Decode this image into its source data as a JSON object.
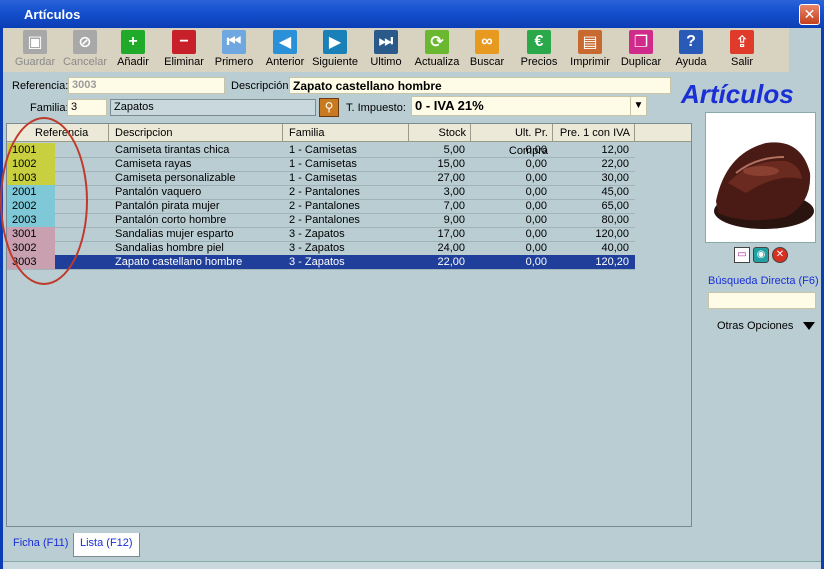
{
  "window": {
    "title": "Artículos",
    "close_label": "✕"
  },
  "toolbar": {
    "buttons": [
      {
        "label": "Guardar",
        "icon": "save-icon",
        "enabled": false,
        "color": "#a8a8a8"
      },
      {
        "label": "Cancelar",
        "icon": "cancel-icon",
        "enabled": false,
        "color": "#a8a8a8"
      },
      {
        "label": "Añadir",
        "icon": "plus-icon",
        "enabled": true,
        "color": "#1faa2a"
      },
      {
        "label": "Eliminar",
        "icon": "minus-icon",
        "enabled": true,
        "color": "#c8202a"
      },
      {
        "label": "Primero",
        "icon": "first-icon",
        "enabled": true,
        "color": "#6fa8e0"
      },
      {
        "label": "Anterior",
        "icon": "previous-icon",
        "enabled": true,
        "color": "#2a90d8"
      },
      {
        "label": "Siguiente",
        "icon": "next-icon",
        "enabled": true,
        "color": "#1a80b8"
      },
      {
        "label": "Ultimo",
        "icon": "last-icon",
        "enabled": true,
        "color": "#2a5a8a"
      },
      {
        "label": "Actualiza",
        "icon": "refresh-icon",
        "enabled": true,
        "color": "#6ab830"
      },
      {
        "label": "Buscar",
        "icon": "binoculars-icon",
        "enabled": true,
        "color": "#e89a20"
      },
      {
        "label": "Precios",
        "icon": "euro-icon",
        "enabled": true,
        "color": "#2aa84a"
      },
      {
        "label": "Imprimir",
        "icon": "printer-icon",
        "enabled": true,
        "color": "#c86a30"
      },
      {
        "label": "Duplicar",
        "icon": "duplicate-icon",
        "enabled": true,
        "color": "#d02a8a"
      },
      {
        "label": "Ayuda",
        "icon": "help-icon",
        "enabled": true,
        "color": "#2a5ab8"
      },
      {
        "label": "Salir",
        "icon": "exit-icon",
        "enabled": true,
        "color": "#e03a2a"
      }
    ]
  },
  "form": {
    "referencia_label": "Referencia:",
    "referencia_value": "3003",
    "descripcion_label": "Descripción:",
    "descripcion_value": "Zapato castellano hombre",
    "familia_label": "Familia:",
    "familia_code": "3",
    "familia_name": "Zapatos",
    "impuesto_label": "T. Impuesto:",
    "impuesto_value": "0 - IVA 21%"
  },
  "app_title": "Artículos",
  "grid": {
    "columns": [
      "Referencia",
      "Descripcion",
      "Familia",
      "Stock",
      "Ult. Pr. Compra",
      "Pre. 1 con IVA"
    ],
    "rows": [
      {
        "ref": "1001",
        "desc": "Camiseta tirantas chica",
        "familia": "1 - Camisetas",
        "stock": "5,00",
        "ult": "0,00",
        "pre": "12,00",
        "color": "#c8d040"
      },
      {
        "ref": "1002",
        "desc": "Camiseta rayas",
        "familia": "1 - Camisetas",
        "stock": "15,00",
        "ult": "0,00",
        "pre": "22,00",
        "color": "#c8d040"
      },
      {
        "ref": "1003",
        "desc": "Camiseta personalizable",
        "familia": "1 - Camisetas",
        "stock": "27,00",
        "ult": "0,00",
        "pre": "30,00",
        "color": "#c8d040"
      },
      {
        "ref": "2001",
        "desc": "Pantalón vaquero",
        "familia": "2 - Pantalones",
        "stock": "3,00",
        "ult": "0,00",
        "pre": "45,00",
        "color": "#7ec8d8"
      },
      {
        "ref": "2002",
        "desc": "Pantalón pirata mujer",
        "familia": "2 - Pantalones",
        "stock": "7,00",
        "ult": "0,00",
        "pre": "65,00",
        "color": "#7ec8d8"
      },
      {
        "ref": "2003",
        "desc": "Pantalón corto hombre",
        "familia": "2 - Pantalones",
        "stock": "9,00",
        "ult": "0,00",
        "pre": "80,00",
        "color": "#7ec8d8"
      },
      {
        "ref": "3001",
        "desc": "Sandalias mujer esparto",
        "familia": "3 - Zapatos",
        "stock": "17,00",
        "ult": "0,00",
        "pre": "120,00",
        "color": "#c8a0b0"
      },
      {
        "ref": "3002",
        "desc": "Sandalias hombre piel",
        "familia": "3 - Zapatos",
        "stock": "24,00",
        "ult": "0,00",
        "pre": "40,00",
        "color": "#c8a0b0"
      },
      {
        "ref": "3003",
        "desc": "Zapato castellano hombre",
        "familia": "3 - Zapatos",
        "stock": "22,00",
        "ult": "0,00",
        "pre": "120,20",
        "color": "#c8a0b0",
        "selected": true
      }
    ]
  },
  "side": {
    "busqueda_label": "Búsqueda Directa (F6)",
    "otras_label": "Otras Opciones"
  },
  "tabs": [
    "Ficha (F11)",
    "Lista (F12)"
  ]
}
